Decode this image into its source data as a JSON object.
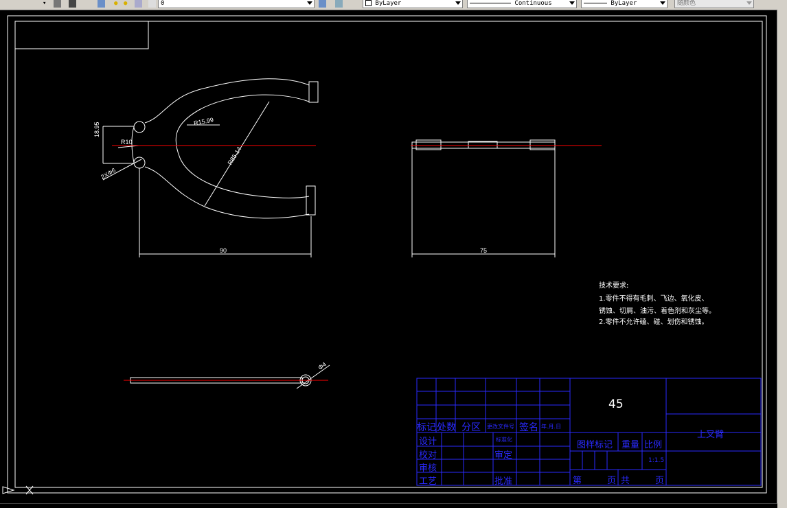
{
  "toolbar": {
    "layer_value": "0",
    "color_value": "ByLayer",
    "linetype_value": "Continuous",
    "lineweight_value": "ByLayer",
    "plotstyle_value": "随颜色"
  },
  "dimensions": {
    "r10": "R10",
    "d1895": "18.95",
    "r1599": "R15.99",
    "r8514": "R85.14",
    "two_phi6": "2XΦ6",
    "d90": "90",
    "d75": "75",
    "phi4": "Φ4"
  },
  "tech_requirements": {
    "title": "技术要求:",
    "lines": [
      "1.零件不得有毛刺、飞边、氧化皮、",
      "  锈蚀、切屑、油污、着色剂和灰尘等。",
      "2.零件不允许磕、碰、划伤和锈蚀。"
    ]
  },
  "title_block": {
    "material": "45",
    "part_name": "上叉臂",
    "marks_label": "标记",
    "count_label": "处数",
    "zone_label": "分区",
    "change_doc_label": "更改文件号",
    "sign_label": "签名",
    "date_label": "年.月.日",
    "design_label": "设计",
    "check_label": "校对",
    "review_label": "审核",
    "process_label": "工艺",
    "standard_label": "标准化",
    "audit_label": "审定",
    "approve_label": "批准",
    "stage_label": "图样标记",
    "weight_label": "重量",
    "scale_label": "比例",
    "scale_value": "1:1.5",
    "sheet_label": "第",
    "page_label": "页",
    "total_label": "共",
    "page_label2": "页"
  },
  "colors": {
    "background": "#000000",
    "line": "#ffffff",
    "centerline": "#ff0000",
    "title_block": "#2a2aff"
  }
}
